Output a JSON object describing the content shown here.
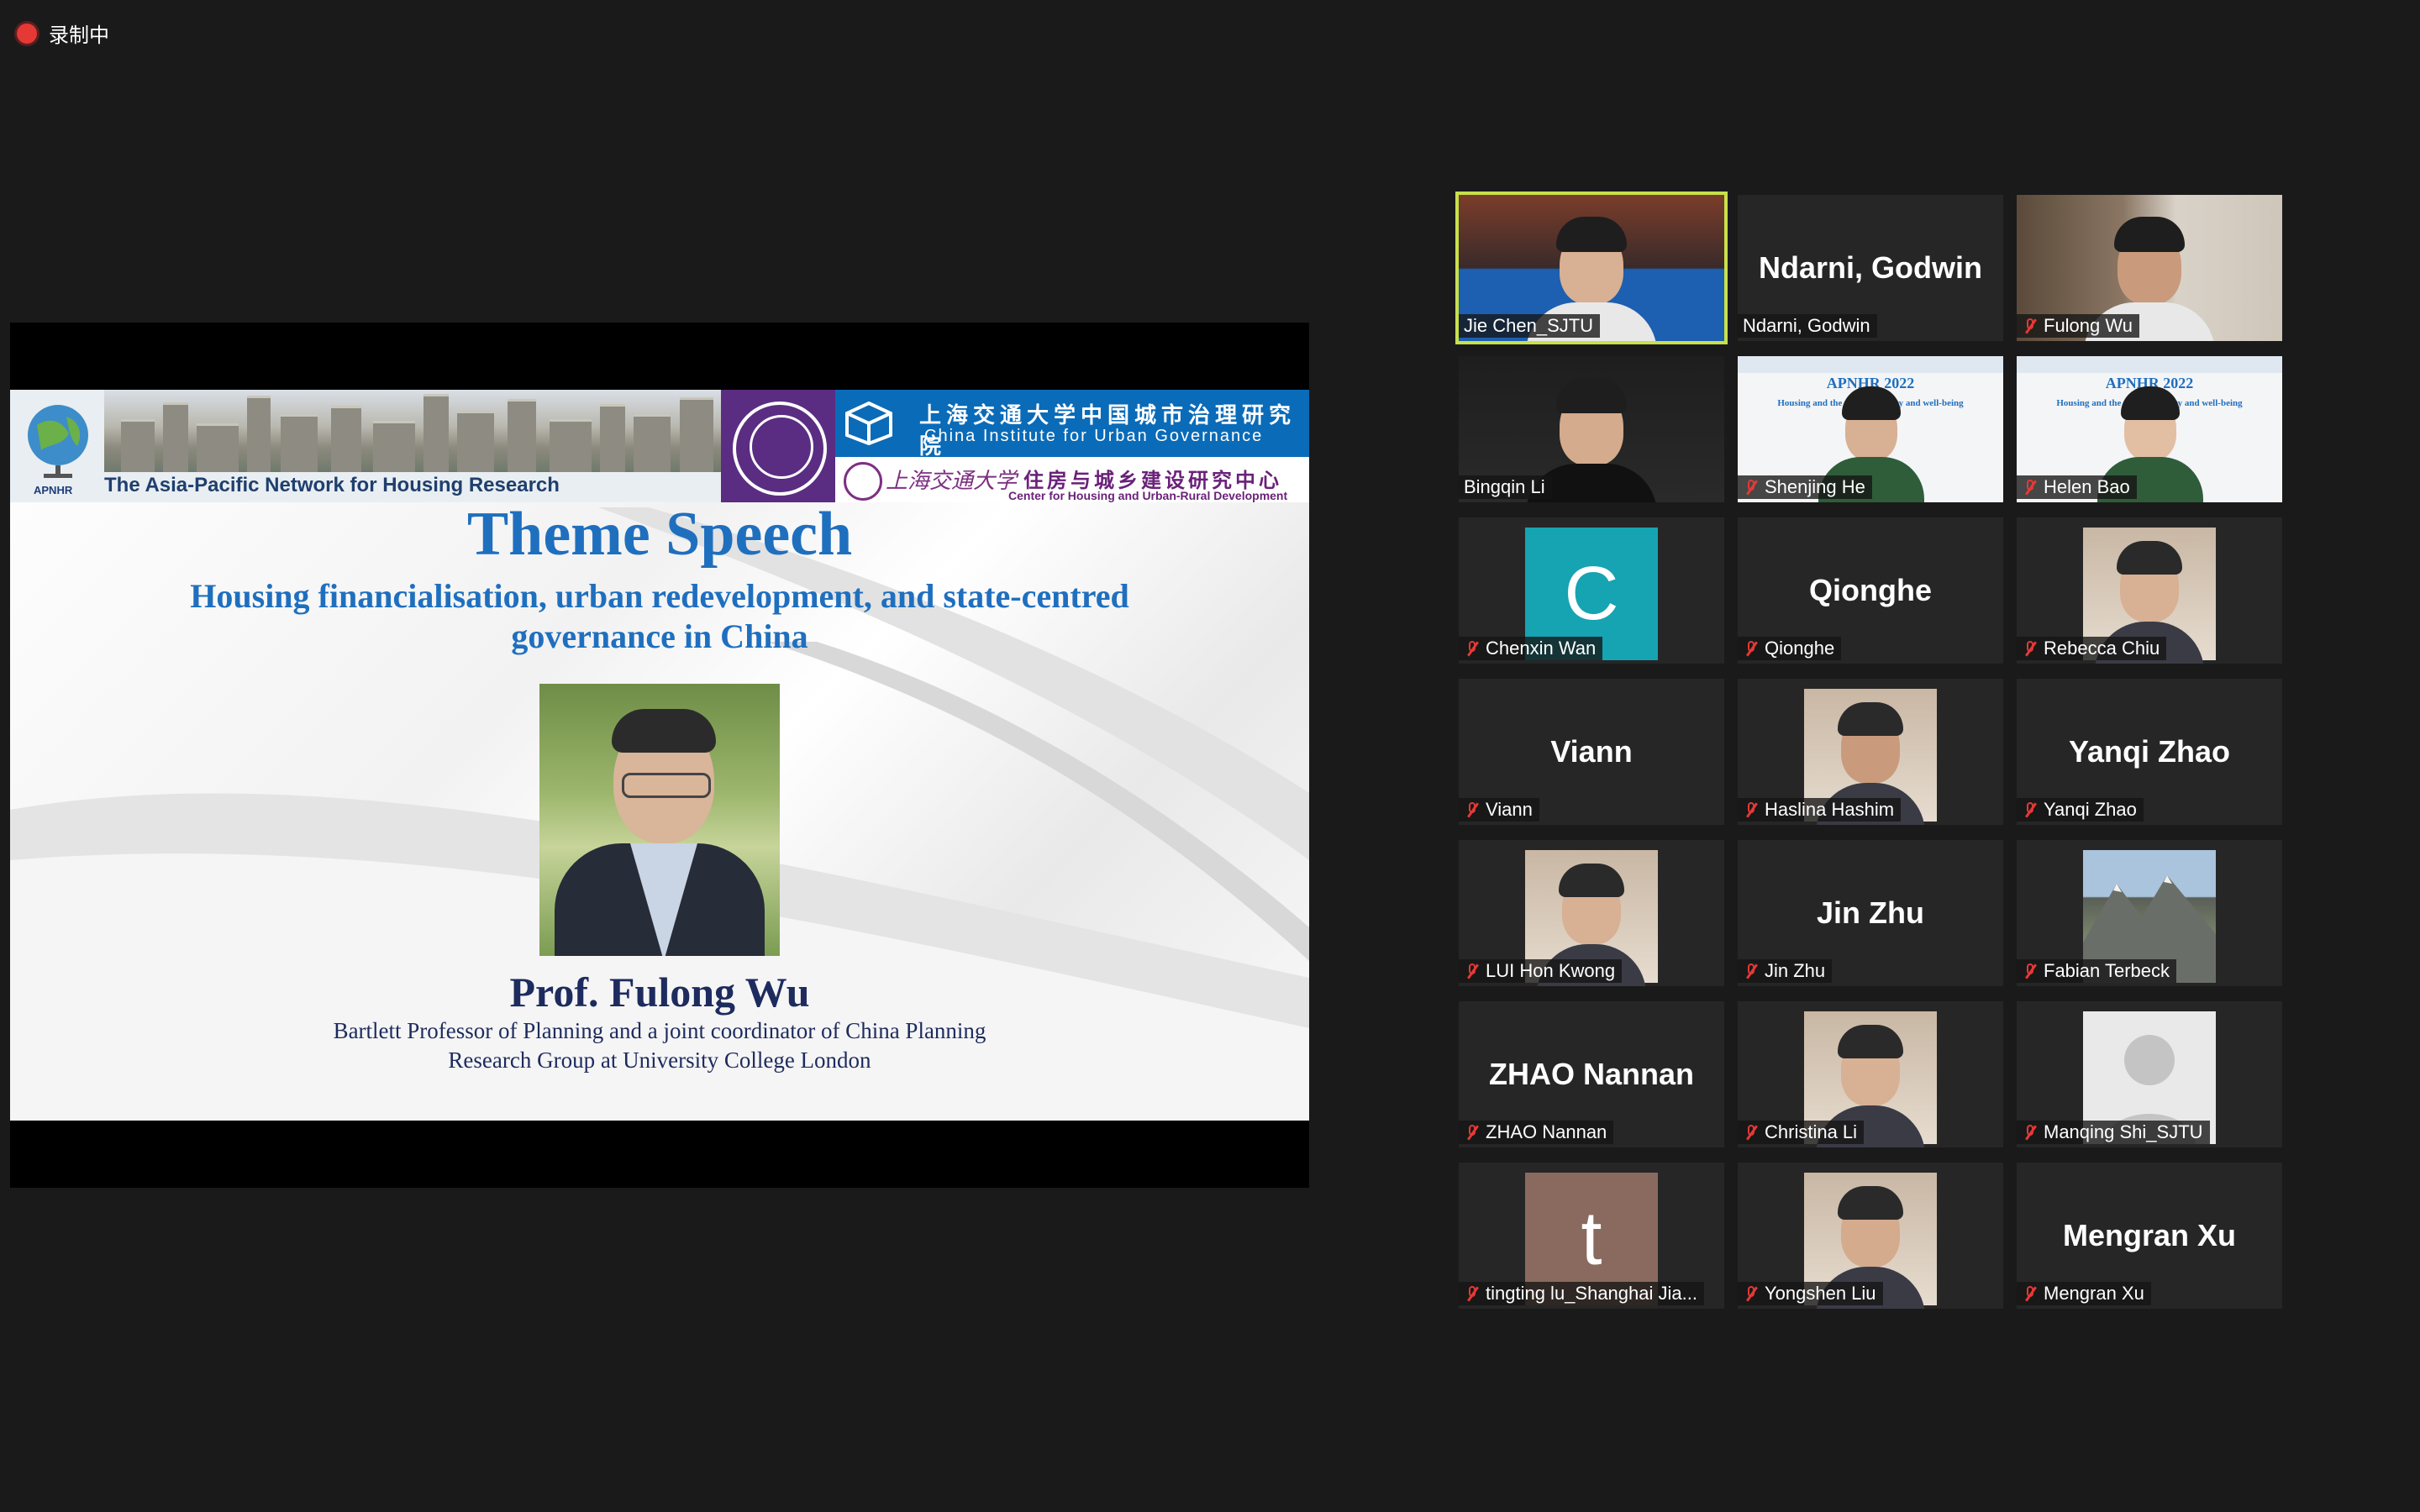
{
  "recording": {
    "label": "录制中"
  },
  "slide": {
    "banner": {
      "org_en": "The Asia-Pacific Network for Housing Research",
      "logo_text": "APNHR",
      "cug_cn": "上海交通大学中国城市治理研究院",
      "cug_en": "China Institute for Urban Governance",
      "sjtu_cn": "上海交通大学",
      "center_cn": "住房与城乡建设研究中心",
      "center_en": "Center for Housing and Urban-Rural Development"
    },
    "title": "Theme Speech",
    "subtitle_line1": "Housing financialisation, urban redevelopment, and state-centred",
    "subtitle_line2": "governance in China",
    "speaker_name": "Prof. Fulong Wu",
    "speaker_title_line1": "Bartlett Professor of Planning and a joint coordinator of China Planning",
    "speaker_title_line2": "Research Group at University College London"
  },
  "participants": [
    {
      "name": "Jie Chen_SJTU",
      "display": "",
      "muted": false,
      "active": true,
      "type": "video"
    },
    {
      "name": "Ndarni, Godwin",
      "display": "Ndarni, Godwin",
      "muted": false,
      "active": false,
      "type": "name"
    },
    {
      "name": "Fulong Wu",
      "display": "",
      "muted": true,
      "active": false,
      "type": "video"
    },
    {
      "name": "Bingqin Li",
      "display": "",
      "muted": false,
      "active": false,
      "type": "video"
    },
    {
      "name": "Shenjing He",
      "display": "",
      "muted": true,
      "active": false,
      "type": "slidecam"
    },
    {
      "name": "Helen Bao",
      "display": "",
      "muted": true,
      "active": false,
      "type": "slidecam"
    },
    {
      "name": "Chenxin Wan",
      "display": "C",
      "muted": true,
      "active": false,
      "type": "letter",
      "color": "#16a3b2"
    },
    {
      "name": "Qionghe",
      "display": "Qionghe",
      "muted": true,
      "active": false,
      "type": "name"
    },
    {
      "name": "Rebecca Chiu",
      "display": "",
      "muted": true,
      "active": false,
      "type": "photo"
    },
    {
      "name": "Viann",
      "display": "Viann",
      "muted": true,
      "active": false,
      "type": "name"
    },
    {
      "name": "Haslina Hashim",
      "display": "",
      "muted": true,
      "active": false,
      "type": "photo"
    },
    {
      "name": "Yanqi Zhao",
      "display": "Yanqi Zhao",
      "muted": true,
      "active": false,
      "type": "name"
    },
    {
      "name": "LUI Hon Kwong",
      "display": "",
      "muted": true,
      "active": false,
      "type": "photo"
    },
    {
      "name": "Jin Zhu",
      "display": "Jin Zhu",
      "muted": true,
      "active": false,
      "type": "name"
    },
    {
      "name": "Fabian Terbeck",
      "display": "",
      "muted": true,
      "active": false,
      "type": "mountain"
    },
    {
      "name": "ZHAO Nannan",
      "display": "ZHAO Nannan",
      "muted": true,
      "active": false,
      "type": "name"
    },
    {
      "name": "Christina Li",
      "display": "",
      "muted": true,
      "active": false,
      "type": "photo"
    },
    {
      "name": "Manqing Shi_SJTU",
      "display": "",
      "muted": true,
      "active": false,
      "type": "avatar"
    },
    {
      "name": "tingting lu_Shanghai Jia...",
      "display": "t",
      "muted": true,
      "active": false,
      "type": "letter",
      "color": "#8a6a5e"
    },
    {
      "name": "Yongshen Liu",
      "display": "",
      "muted": true,
      "active": false,
      "type": "photo"
    },
    {
      "name": "Mengran Xu",
      "display": "Mengran Xu",
      "muted": true,
      "active": false,
      "type": "name"
    }
  ],
  "colors": {
    "accent": "#c8e04a",
    "muted_icon": "#e53935",
    "slide_blue": "#1f6fbf",
    "slide_navy": "#1d2b5e"
  }
}
